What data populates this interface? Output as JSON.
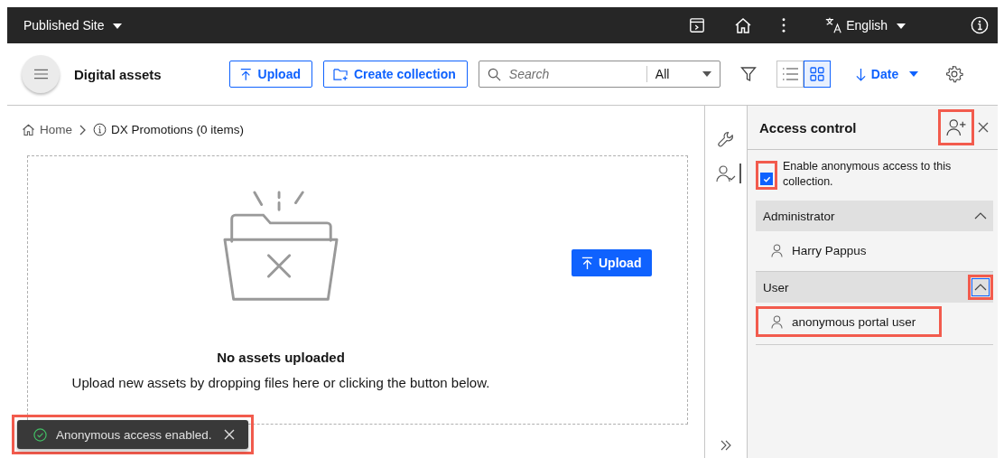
{
  "top_bar": {
    "site": "Published Site",
    "language": "English"
  },
  "toolbar": {
    "title": "Digital assets",
    "upload": "Upload",
    "create": "Create collection",
    "search": {
      "placeholder": "Search"
    },
    "filter_value": "All",
    "view_modes": [
      {
        "kind": "list",
        "selected": false
      },
      {
        "kind": "grid",
        "selected": true
      }
    ],
    "sort": "Date"
  },
  "breadcrumb": [
    {
      "kind": "home",
      "label": "Home"
    },
    {
      "kind": "info",
      "label": "DX Promotions (0 items)"
    }
  ],
  "empty_state": {
    "title": "No assets uploaded",
    "message": "Upload new assets by dropping files here or clicking the button below.",
    "button": "Upload"
  },
  "toast": {
    "message": "Anonymous access enabled.",
    "highlighted": true
  },
  "side_rail": [
    {
      "kind": "tools",
      "selected": false
    },
    {
      "kind": "access",
      "selected": true
    }
  ],
  "panel": {
    "title": "Access control",
    "add_highlighted": true,
    "anonymous": {
      "label": "Enable anonymous access to this collection.",
      "checked": true,
      "highlighted": true
    },
    "groups": [
      {
        "name": "Administrator",
        "expanded": true,
        "highlighted": false,
        "members": [
          {
            "name": "Harry Pappus",
            "highlighted": false
          }
        ]
      },
      {
        "name": "User",
        "expanded": true,
        "highlighted": true,
        "members": [
          {
            "name": "anonymous portal user",
            "highlighted": true
          }
        ]
      }
    ]
  }
}
